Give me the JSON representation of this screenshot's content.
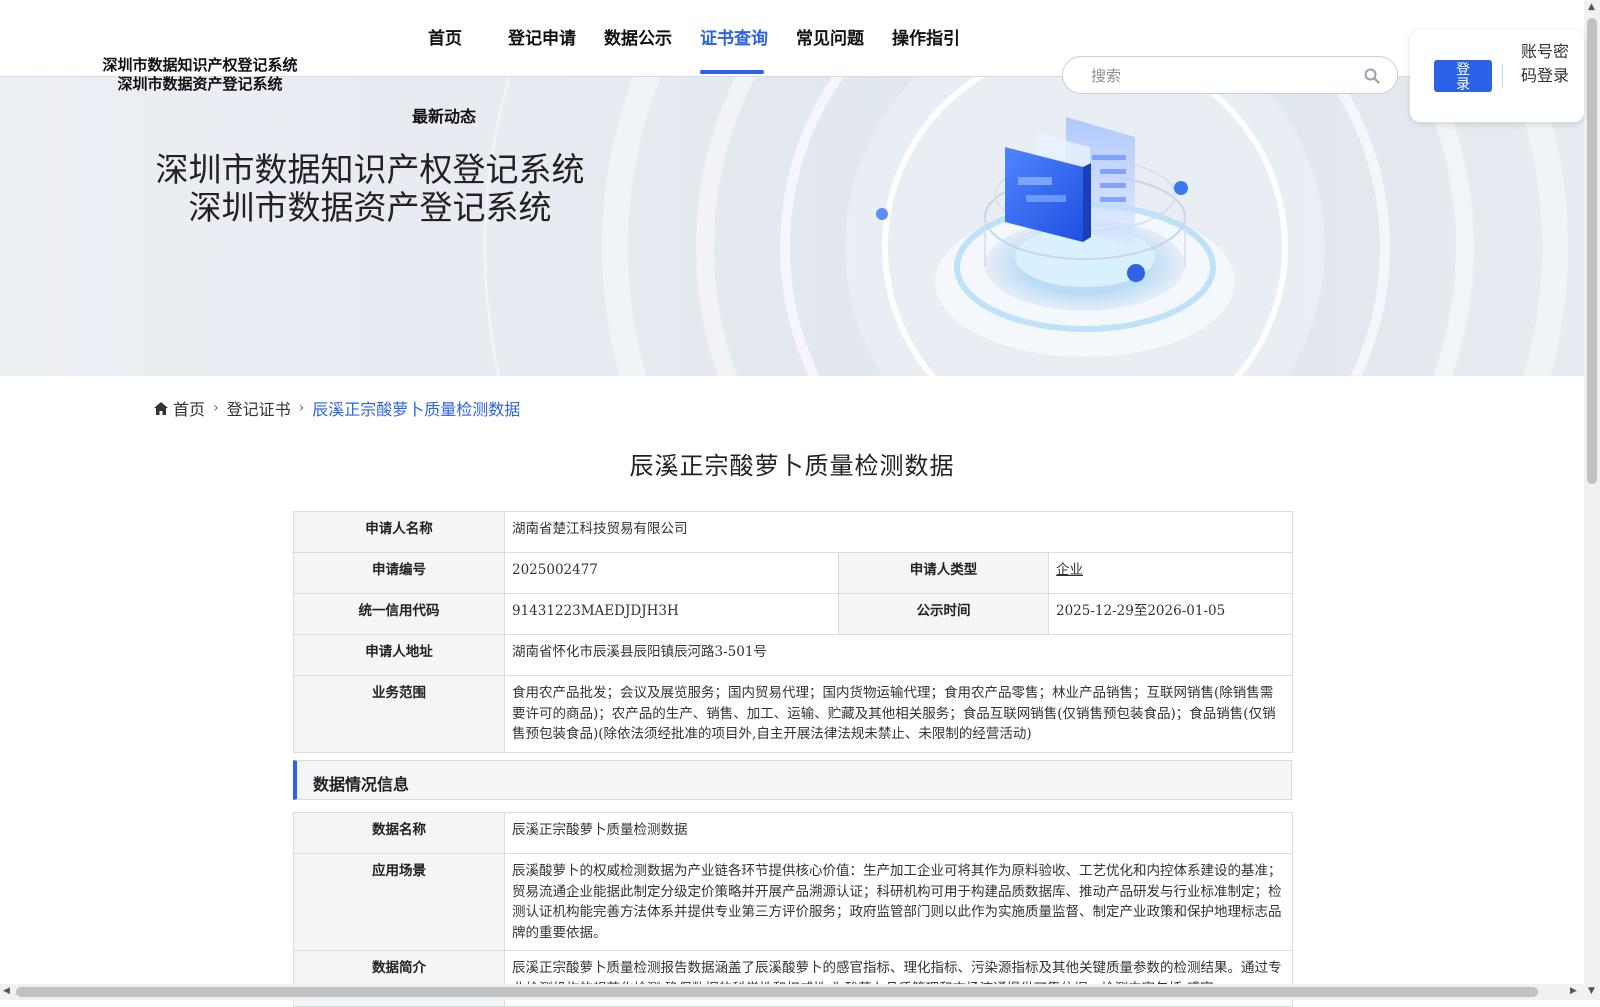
{
  "header": {
    "logo_line1": "深圳市数据知识产权登记系统",
    "logo_line2": "深圳市数据资产登记系统",
    "nav": [
      {
        "label": "首页",
        "active": false
      },
      {
        "label": "登记申请",
        "active": false
      },
      {
        "label": "数据公示",
        "active": false
      },
      {
        "label": "证书查询",
        "active": true
      },
      {
        "label": "常见问题",
        "active": false
      },
      {
        "label": "操作指引",
        "active": false
      }
    ],
    "nav_sub": "最新动态",
    "search_placeholder": "搜索",
    "login_button": "登录",
    "account_login": "账号密码登录"
  },
  "banner": {
    "title_line1": "深圳市数据知识产权登记系统",
    "title_line2": "深圳市数据资产登记系统"
  },
  "breadcrumb": {
    "home": "首页",
    "level2": "登记证书",
    "current": "辰溪正宗酸萝卜质量检测数据"
  },
  "page_title": "辰溪正宗酸萝卜质量检测数据",
  "applicant": {
    "name_label": "申请人名称",
    "name_value": "湖南省楚江科技贸易有限公司",
    "number_label": "申请编号",
    "number_value": "2025002477",
    "type_label": "申请人类型",
    "type_value": "企业",
    "credit_label": "统一信用代码",
    "credit_value": "91431223MAEDJDJH3H",
    "publicity_label": "公示时间",
    "publicity_value": "2025-12-29至2026-01-05",
    "address_label": "申请人地址",
    "address_value": "湖南省怀化市辰溪县辰阳镇辰河路3-501号",
    "scope_label": "业务范围",
    "scope_value": "食用农产品批发；会议及展览服务；国内贸易代理；国内货物运输代理；食用农产品零售；林业产品销售；互联网销售(除销售需要许可的商品)；农产品的生产、销售、加工、运输、贮藏及其他相关服务；食品互联网销售(仅销售预包装食品)；食品销售(仅销售预包装食品)(除依法须经批准的项目外,自主开展法律法规未禁止、未限制的经营活动)"
  },
  "data_section": {
    "heading": "数据情况信息",
    "data_name_label": "数据名称",
    "data_name_value": "辰溪正宗酸萝卜质量检测数据",
    "scenario_label": "应用场景",
    "scenario_value": "辰溪酸萝卜的权威检测数据为产业链各环节提供核心价值：生产加工企业可将其作为原料验收、工艺优化和内控体系建设的基准；贸易流通企业能据此制定分级定价策略并开展产品溯源认证；科研机构可用于构建品质数据库、推动产品研发与行业标准制定；检测认证机构能完善方法体系并提供专业第三方评价服务；政府监管部门则以此作为实施质量监督、制定产业政策和保护地理标志品牌的重要依据。",
    "summary_label": "数据简介",
    "summary_value": "辰溪正宗酸萝卜质量检测报告数据涵盖了辰溪酸萝卜的感官指标、理化指标、污染源指标及其他关键质量参数的检测结果。通过专业检测机构的规范化检测,确保数据的科学性和权威性,为酸萝卜品质管理和市场流通提供可靠依据。检测内容包括:感官"
  },
  "colors": {
    "accent": "#2b62e8",
    "label_bg": "#f4f5f7",
    "border": "#d9dce1"
  }
}
